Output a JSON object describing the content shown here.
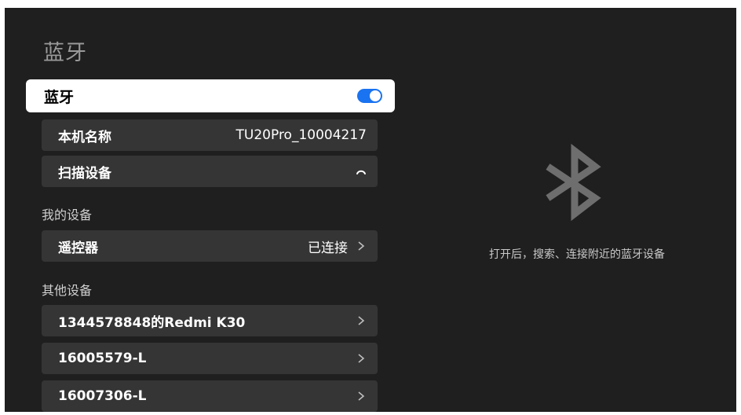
{
  "page": {
    "title": "蓝牙"
  },
  "bluetooth_toggle": {
    "label": "蓝牙",
    "state": "on",
    "color": "#1a73f0"
  },
  "device_name": {
    "label": "本机名称",
    "value": "TU20Pro_10004217"
  },
  "scan": {
    "label": "扫描设备",
    "icon": "loading-spinner-icon"
  },
  "my_devices": {
    "title": "我的设备",
    "items": [
      {
        "name": "遥控器",
        "status": "已连接"
      }
    ]
  },
  "other_devices": {
    "title": "其他设备",
    "items": [
      {
        "name": "1344578848的Redmi K30"
      },
      {
        "name": "16005579-L"
      },
      {
        "name": "16007306-L"
      }
    ]
  },
  "info_panel": {
    "icon": "bluetooth-icon",
    "hint": "打开后，搜索、连接附近的蓝牙设备"
  }
}
